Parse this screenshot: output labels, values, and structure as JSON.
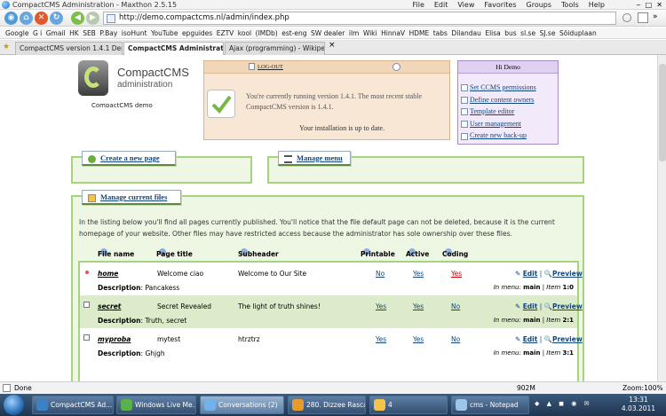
{
  "window": {
    "title": "CompactCMS Administration - Maxthon 2.5.15",
    "menu": [
      "File",
      "Edit",
      "View",
      "Favorites",
      "Groups",
      "Tools",
      "Help"
    ]
  },
  "nav": {
    "url": "http://demo.compactcms.nl/admin/index.php"
  },
  "bookmarks": [
    "Google",
    "G i",
    "Gmail",
    "HK",
    "SEB",
    "P.Bay",
    "isoHunt",
    "YouTube",
    "epguides",
    "EZTV",
    "kool",
    "(IMDb)",
    "est-eng",
    "SW dealer",
    "ilm",
    "Wiki",
    "HinnaV",
    "HDME",
    "tabs",
    "Dilandau",
    "Elisa",
    "bus",
    "sl.se",
    "SJ.se",
    "Sõiduplaan"
  ],
  "tabs": [
    {
      "label": "CompactCMS version 1.4.1 Demo..."
    },
    {
      "label": "CompactCMS Administration"
    },
    {
      "label": "Ajax (programming) - Wikipedia, ..."
    }
  ],
  "logo": {
    "title": "CompactCMS",
    "subtitle": "administration",
    "demo": "CompactCMS demo"
  },
  "info": {
    "logout": "Log-out",
    "message": "You're currently running version 1.4.1. The most recent stable CompactCMS version is 1.4.1.",
    "uptodate": "Your installation is up to date."
  },
  "hi": {
    "header": "Hi Demo",
    "links": [
      "Set CCMS permissions",
      "Define content owners",
      "Template editor",
      "User management",
      "Create new back-up"
    ]
  },
  "panels": {
    "create": "Create a new page",
    "menu": "Manage menu",
    "files": "Manage current files",
    "files_desc": "In the listing below you'll find all pages currently published. You'll notice that the file default page can not be deleted, because it is the current homepage of your website. Other files may have restricted access because the administrator has sole ownership over these files."
  },
  "table": {
    "headers": {
      "file": "File name",
      "title": "Page title",
      "subheader": "Subheader",
      "printable": "Printable",
      "active": "Active",
      "coding": "Coding"
    },
    "edit": "Edit",
    "preview": "Preview",
    "desc_label": "Description",
    "inmenu_label": "In menu:",
    "item_label": "Item",
    "rows": [
      {
        "file": "home",
        "title": "Welcome ciao",
        "subheader": "Welcome to Our Site",
        "printable": "No",
        "active": "Yes",
        "coding": "Yes",
        "description": "Pancakess",
        "menu": "main",
        "item": "1:0"
      },
      {
        "file": "secret",
        "title": "Secret Revealed",
        "subheader": "The light of truth shines!",
        "printable": "Yes",
        "active": "Yes",
        "coding": "No",
        "description": "Truth, secret",
        "menu": "main",
        "item": "2:1"
      },
      {
        "file": "myproba",
        "title": "mytest",
        "subheader": "htrztrz",
        "printable": "Yes",
        "active": "Yes",
        "coding": "No",
        "description": "Ghjgh",
        "menu": "main",
        "item": "3:1"
      }
    ]
  },
  "statusbar": {
    "left": "Done",
    "memory": "902M",
    "zoom": "Zoom:100%"
  },
  "taskbar": {
    "tasks": [
      {
        "label": "CompactCMS Ad..."
      },
      {
        "label": "Windows Live Me..."
      },
      {
        "label": "Conversations (2)"
      },
      {
        "label": "280. Dizzee Rascal..."
      },
      {
        "label": "4"
      },
      {
        "label": "cms - Notepad"
      }
    ],
    "time": "13:31",
    "date": "4.03.2011"
  },
  "colors": {
    "green_border": "#a6d37e",
    "green_bg": "#eef7e4",
    "link": "#12457c",
    "peach": "#f7e7d4",
    "lilac": "#f2eafa"
  }
}
